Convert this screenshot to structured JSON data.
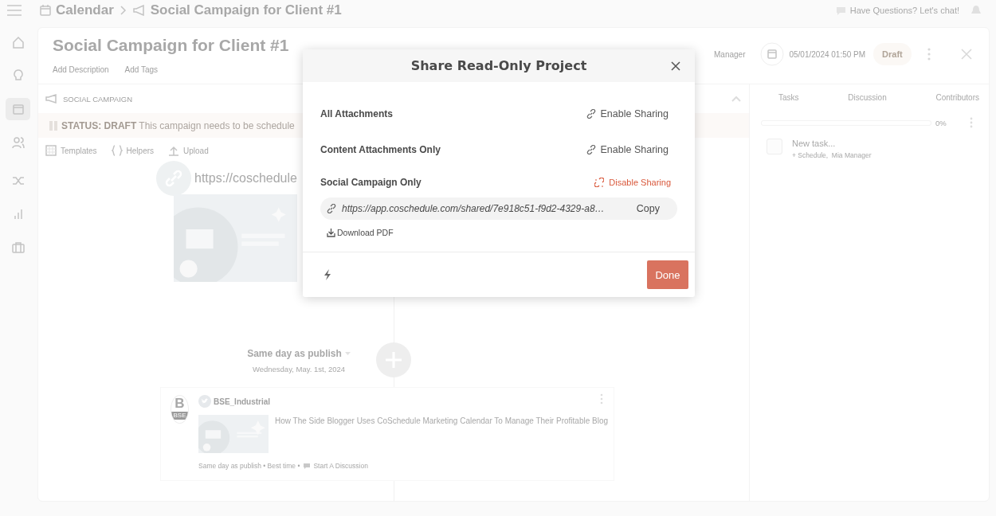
{
  "top_bar": {
    "breadcrumb": [
      {
        "label": "Calendar"
      },
      {
        "label": "Social Campaign for Client #1"
      }
    ],
    "chat_link": "Have Questions? Let's chat!"
  },
  "nav_rail": {
    "items": [
      {
        "selected": false
      },
      {
        "selected": false
      },
      {
        "selected": true
      },
      {
        "selected": false
      },
      {
        "selected": false
      },
      {
        "selected": false
      },
      {
        "selected": false
      }
    ]
  },
  "project": {
    "title": "Social Campaign for Client #1",
    "links": [
      "Add Description",
      "Add Tags"
    ],
    "owner": "Manager",
    "date": "05/01/2024 01:50 PM",
    "status": "Draft"
  },
  "campaign": {
    "heading": "SOCIAL CAMPAIGN",
    "status_message": "**STATUS: DRAFT** This campaign needs to be schedule",
    "tools": [
      "Templates",
      "Helpers",
      "Upload"
    ],
    "link_url": "https://coschedule",
    "timeline_when": "Same day as publish",
    "timeline_date": "Wednesday, May. 1st, 2024",
    "post": {
      "avatar_letter": "B",
      "avatar_caption": "BSE",
      "account": "BSE_Industrial",
      "text": "How The Side Blogger Uses CoSchedule Marketing Calendar To Manage Their Profitable Blog",
      "meta": "Same day as publish • Best time •",
      "discussion": "Start A Discussion"
    }
  },
  "side_panel": {
    "tabs": [
      {
        "label": "Tasks"
      },
      {
        "label": "Discussion"
      },
      {
        "label": "Contributors"
      }
    ],
    "progress": {
      "level": 0,
      "reading": "0%"
    },
    "new_task": {
      "placeholder": "New task...",
      "checked": false
    },
    "task_meta": "+ Schedule,  Mia Manager"
  },
  "modal": {
    "title": "Share Read-Only Project",
    "options": [
      {
        "label": "All Attachments",
        "sharing": false,
        "action": "Enable Sharing"
      },
      {
        "label": "Content Attachments Only",
        "sharing": false,
        "action": "Enable Sharing"
      },
      {
        "label": "Social Campaign Only",
        "sharing": true,
        "action": "Disable Sharing",
        "url": "https://app.coschedule.com/shared/7e918c51-f9d2-4329-a8…",
        "copy": "Copy",
        "download": "Download PDF"
      }
    ],
    "done": "Done"
  }
}
